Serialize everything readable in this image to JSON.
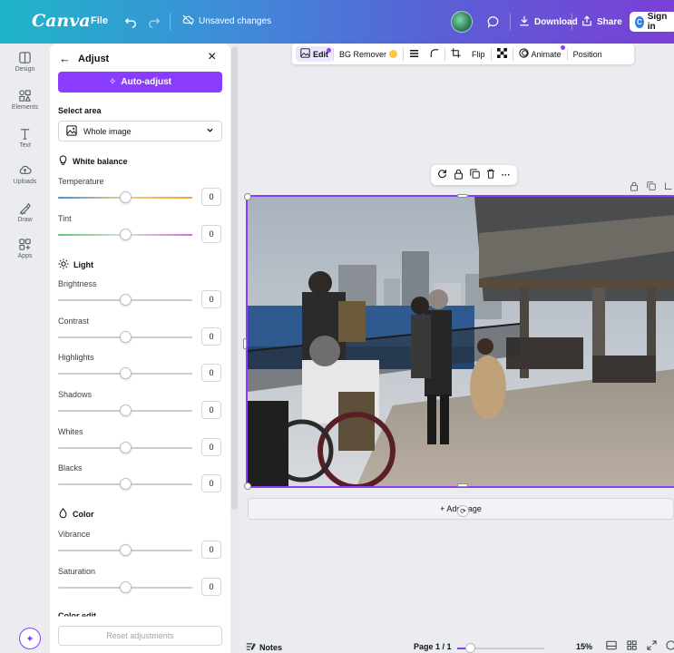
{
  "app": {
    "logo": "Canva"
  },
  "topbar": {
    "file_label": "File",
    "unsaved_label": "Unsaved changes",
    "download_label": "Download",
    "share_label": "Share",
    "signin_label": "Sign in"
  },
  "rail": {
    "items": [
      {
        "label": "Design",
        "icon": "design-icon"
      },
      {
        "label": "Elements",
        "icon": "elements-icon"
      },
      {
        "label": "Text",
        "icon": "text-icon"
      },
      {
        "label": "Uploads",
        "icon": "uploads-icon"
      },
      {
        "label": "Draw",
        "icon": "draw-icon"
      },
      {
        "label": "Apps",
        "icon": "apps-icon"
      }
    ]
  },
  "panel": {
    "title": "Adjust",
    "auto_adjust_label": "Auto-adjust",
    "select_area_heading": "Select area",
    "select_area_value": "Whole image",
    "white_balance_heading": "White balance",
    "light_heading": "Light",
    "color_heading": "Color",
    "color_edit_heading": "Color edit",
    "reset_label": "Reset adjustments",
    "sliders": {
      "temperature": {
        "label": "Temperature",
        "value": "0"
      },
      "tint": {
        "label": "Tint",
        "value": "0"
      },
      "brightness": {
        "label": "Brightness",
        "value": "0"
      },
      "contrast": {
        "label": "Contrast",
        "value": "0"
      },
      "highlights": {
        "label": "Highlights",
        "value": "0"
      },
      "shadows": {
        "label": "Shadows",
        "value": "0"
      },
      "whites": {
        "label": "Whites",
        "value": "0"
      },
      "blacks": {
        "label": "Blacks",
        "value": "0"
      },
      "vibrance": {
        "label": "Vibrance",
        "value": "0"
      },
      "saturation": {
        "label": "Saturation",
        "value": "0"
      }
    }
  },
  "context_toolbar": {
    "edit_label": "Edit",
    "bg_remover_label": "BG Remover",
    "flip_label": "Flip",
    "animate_label": "Animate",
    "position_label": "Position"
  },
  "canvas": {
    "add_page_label": "+ Add page"
  },
  "bottombar": {
    "notes_label": "Notes",
    "page_indicator": "Page 1 / 1",
    "zoom_value": "15%",
    "zoom_fraction": 0.15
  },
  "colors": {
    "accent": "#8b3dff",
    "header_gradient_start": "#1fb5c9",
    "header_gradient_end": "#7a3fd6"
  }
}
